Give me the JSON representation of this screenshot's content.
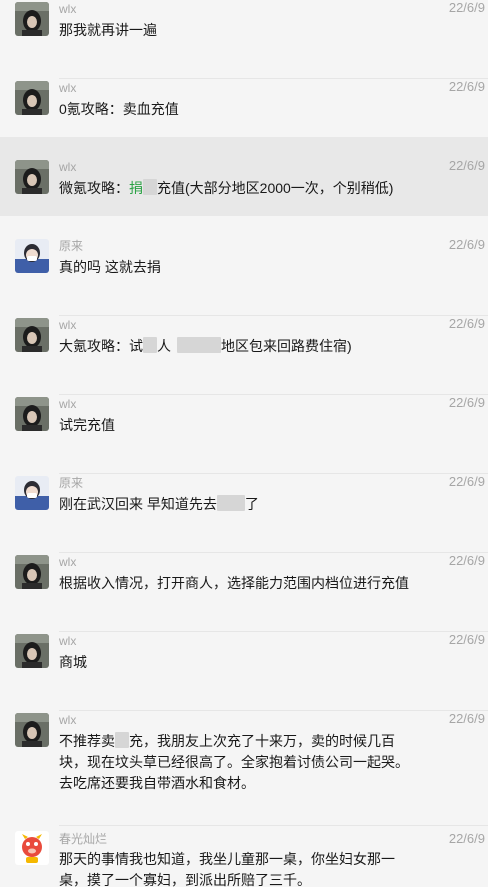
{
  "messages": [
    {
      "sender": "wlx",
      "time": "22/6/9",
      "text": "那我就再讲一遍"
    },
    {
      "sender": "wlx",
      "time": "22/6/9",
      "text": "0氪攻略：卖血充值"
    },
    {
      "sender": "wlx",
      "time": "22/6/9",
      "text_a": "微氪攻略：",
      "text_b": "捐",
      "text_c": "充值(大部分地区2000一次，个别稍低)"
    },
    {
      "sender": "原来",
      "time": "22/6/9",
      "text": "真的吗 这就去捐"
    },
    {
      "sender": "wlx",
      "time": "22/6/9",
      "text_a": "大氪攻略：试",
      "text_b": "人",
      "text_c": "地区包来回路费住宿)"
    },
    {
      "sender": "wlx",
      "time": "22/6/9",
      "text": "试完充值"
    },
    {
      "sender": "原来",
      "time": "22/6/9",
      "text_a": "刚在武汉回来 早知道先去",
      "text_b": "了"
    },
    {
      "sender": "wlx",
      "time": "22/6/9",
      "text": "根据收入情况，打开商人，选择能力范围内档位进行充值"
    },
    {
      "sender": "wlx",
      "time": "22/6/9",
      "text": "商城"
    },
    {
      "sender": "wlx",
      "time": "22/6/9",
      "text_a": "不推荐卖",
      "text_b": "充，我朋友上次充了十来万，卖的时候几百块，现在坟头草已经很高了。全家抱着讨债公司一起哭。去吃席还要我自带酒水和食材。"
    },
    {
      "sender": "春光灿烂",
      "time": "22/6/9",
      "text": "那天的事情我也知道，我坐儿童那一桌，你坐妇女那一桌，摸了一个寡妇，到派出所赔了三千。"
    }
  ]
}
